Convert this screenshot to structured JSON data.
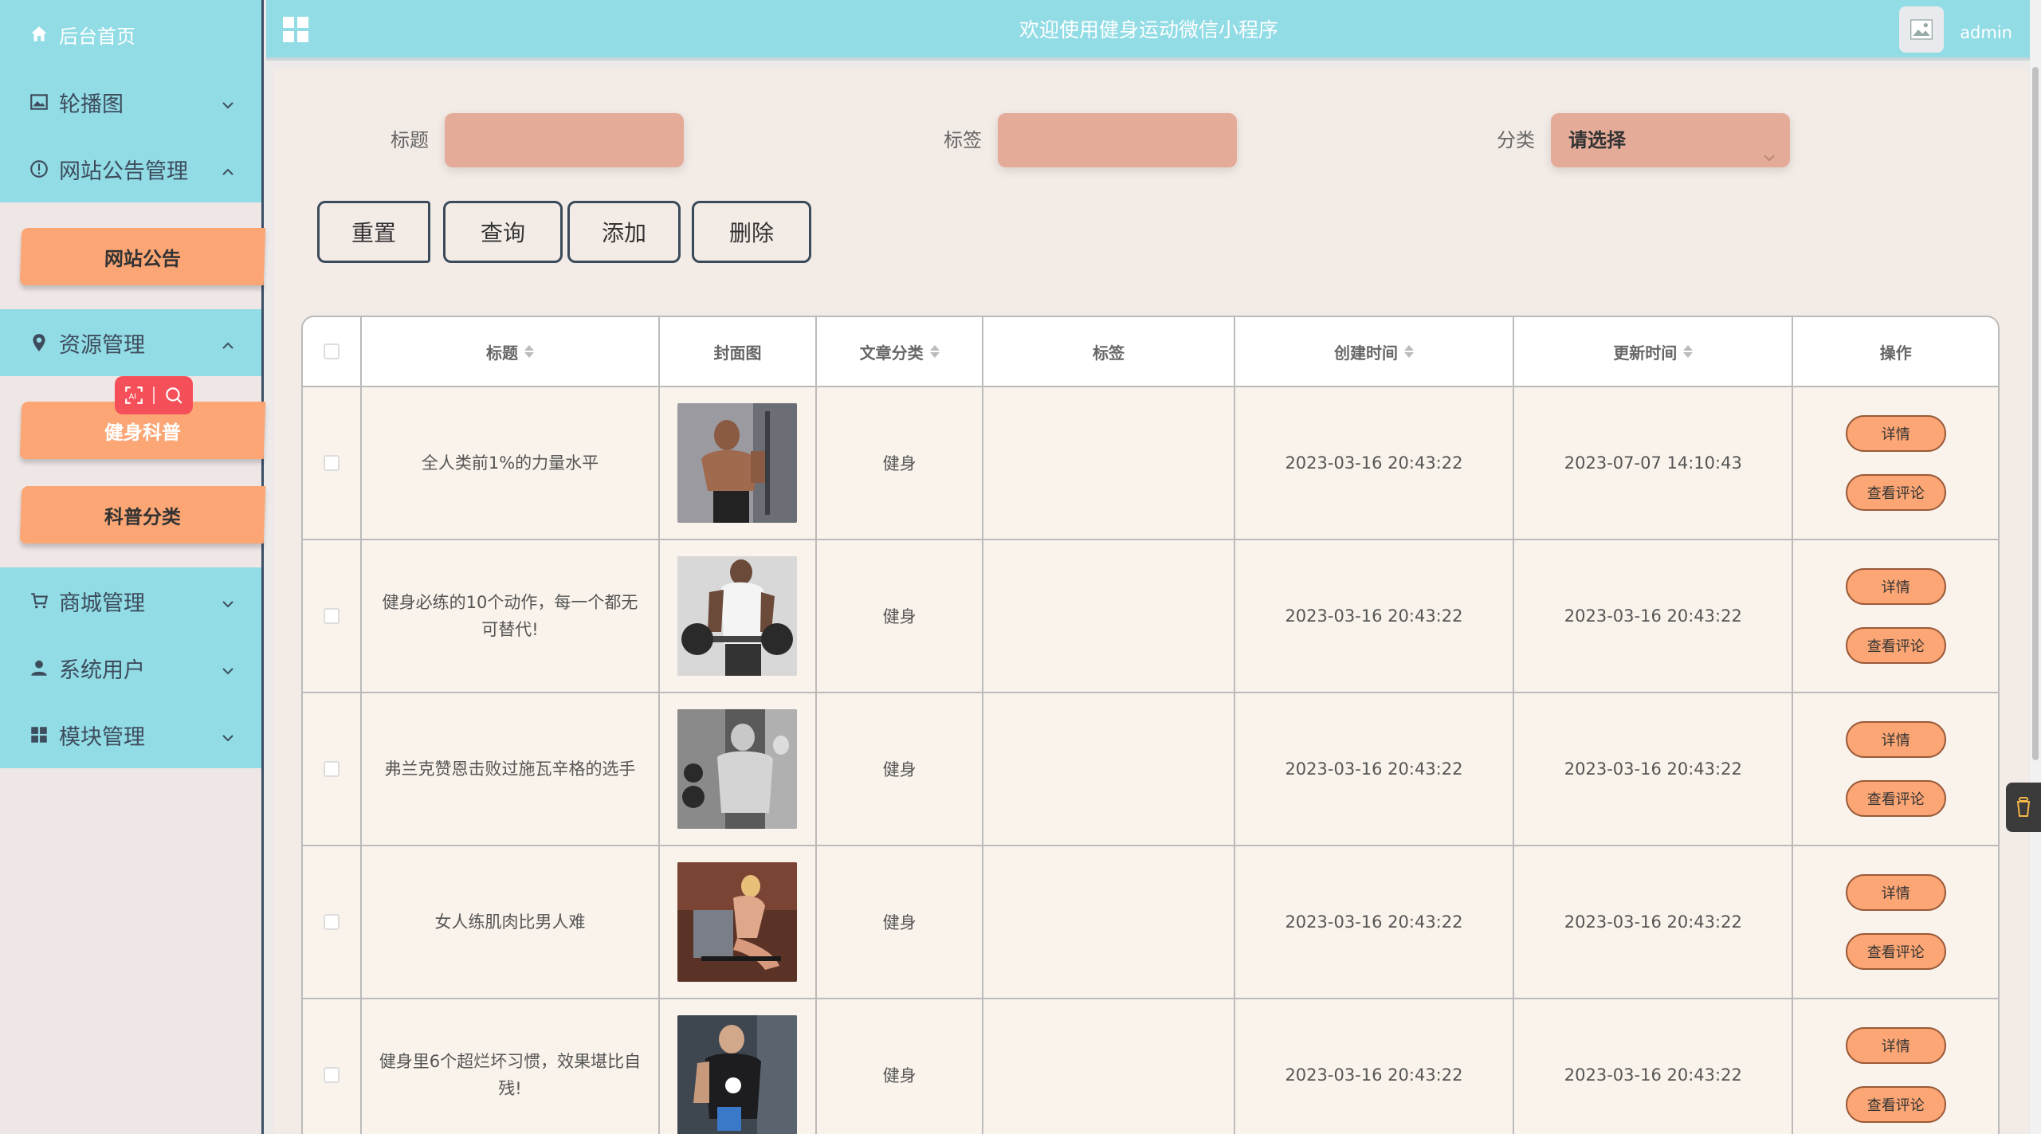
{
  "app": {
    "header_title": "欢迎使用健身运动微信小程序",
    "username": "admin"
  },
  "sidebar": {
    "home": "后台首页",
    "menus": [
      {
        "label": "轮播图",
        "icon": "image-icon",
        "expanded": false
      },
      {
        "label": "网站公告管理",
        "icon": "info-circle-icon",
        "expanded": true,
        "children": [
          "网站公告"
        ]
      },
      {
        "label": "资源管理",
        "icon": "location-pin-icon",
        "expanded": true,
        "children": [
          "健身科普",
          "科普分类"
        ]
      },
      {
        "label": "商城管理",
        "icon": "cart-icon",
        "expanded": false
      },
      {
        "label": "系统用户",
        "icon": "user-icon",
        "expanded": false
      },
      {
        "label": "模块管理",
        "icon": "grid-icon",
        "expanded": false
      }
    ]
  },
  "search": {
    "title_label": "标题",
    "title_value": "",
    "tag_label": "标签",
    "tag_value": "",
    "category_label": "分类",
    "category_value": "请选择"
  },
  "toolbar": {
    "reset": "重置",
    "query": "查询",
    "add": "添加",
    "delete": "删除"
  },
  "table": {
    "columns": [
      "标题",
      "封面图",
      "文章分类",
      "标签",
      "创建时间",
      "更新时间",
      "操作"
    ],
    "sortable": [
      true,
      false,
      true,
      false,
      true,
      true,
      false
    ],
    "detail_label": "详情",
    "comments_label": "查看评论",
    "rows": [
      {
        "title": "全人类前1%的力量水平",
        "category": "健身",
        "tag": "",
        "created": "2023-03-16 20:43:22",
        "updated": "2023-07-07 14:10:43"
      },
      {
        "title": "健身必练的10个动作，每一个都无可替代!",
        "category": "健身",
        "tag": "",
        "created": "2023-03-16 20:43:22",
        "updated": "2023-03-16 20:43:22"
      },
      {
        "title": "弗兰克赞恩击败过施瓦辛格的选手",
        "category": "健身",
        "tag": "",
        "created": "2023-03-16 20:43:22",
        "updated": "2023-03-16 20:43:22"
      },
      {
        "title": "女人练肌肉比男人难",
        "category": "健身",
        "tag": "",
        "created": "2023-03-16 20:43:22",
        "updated": "2023-03-16 20:43:22"
      },
      {
        "title": "健身里6个超烂坏习惯，效果堪比自残!",
        "category": "健身",
        "tag": "",
        "created": "2023-03-16 20:43:22",
        "updated": "2023-03-16 20:43:22"
      }
    ]
  },
  "colors": {
    "header": "#92dce6",
    "sidebar_active": "#fba674",
    "input": "#e3ab98",
    "table_bg": "#faf3ec"
  }
}
